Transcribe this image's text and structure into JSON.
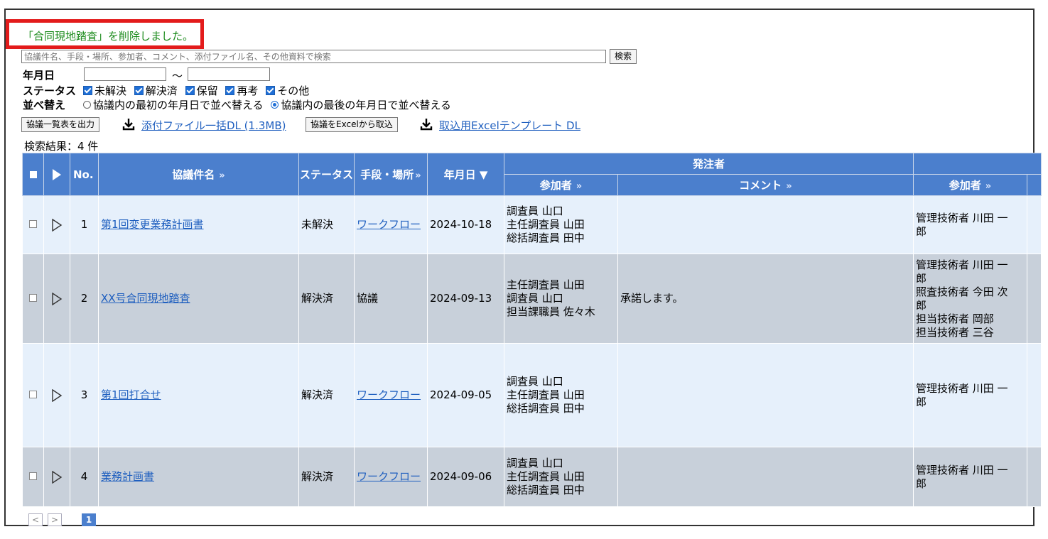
{
  "message": "「合同現地踏査」を削除しました。",
  "search": {
    "placeholder": "協議件名、手段・場所、参加者、コメント、添付ファイル名、その他資料で検索",
    "button": "検索"
  },
  "filters": {
    "date_label": "年月日",
    "tilde": "～",
    "status_label": "ステータス",
    "status_options": [
      "未解決",
      "解決済",
      "保留",
      "再考",
      "その他"
    ],
    "sort_label": "並べ替え",
    "sort_options": [
      "協議内の最初の年月日で並べ替える",
      "協議内の最後の年月日で並べ替える"
    ]
  },
  "actions": {
    "export_button": "協議一覧表を出力",
    "attach_dl": "添付ファイル一括DL (1.3MB)",
    "import_button": "協議をExcelから取込",
    "template_dl": "取込用Excelテンプレート DL"
  },
  "result_count": "検索結果：4 件",
  "table": {
    "headers": {
      "no": "No.",
      "title": "協議件名",
      "status": "ステータス",
      "method": "手段・場所",
      "date": "年月日 ▼",
      "orderer": "発注者",
      "participants": "参加者",
      "comment": "コメント",
      "contractor_participants": "参加者",
      "chev": "»"
    },
    "rows": [
      {
        "no": "1",
        "title": "第1回変更業務計画書",
        "status": "未解決",
        "method": "ワークフロー",
        "date": "2024-10-18",
        "participants": [
          "調査員 山口",
          "主任調査員 山田",
          "総括調査員 田中"
        ],
        "comment": "",
        "contractor": [
          "管理技術者 川田 一",
          "郎"
        ]
      },
      {
        "no": "2",
        "title": "XX号合同現地踏査",
        "status": "解決済",
        "method": "協議",
        "date": "2024-09-13",
        "participants": [
          "主任調査員 山田",
          "調査員 山口",
          "担当課職員 佐々木"
        ],
        "comment": "承諾します。",
        "contractor": [
          "管理技術者 川田 一",
          "郎",
          "照査技術者 今田 次",
          "郎",
          "担当技術者 岡部",
          "担当技術者 三谷"
        ]
      },
      {
        "no": "3",
        "title": "第1回打合せ",
        "status": "解決済",
        "method": "ワークフロー",
        "date": "2024-09-05",
        "participants": [
          "調査員 山口",
          "主任調査員 山田",
          "総括調査員 田中"
        ],
        "comment": "",
        "contractor": [
          "管理技術者 川田 一",
          "郎"
        ]
      },
      {
        "no": "4",
        "title": "業務計画書",
        "status": "解決済",
        "method": "ワークフロー",
        "date": "2024-09-06",
        "participants": [
          "調査員 山口",
          "主任調査員 山田",
          "総括調査員 田中"
        ],
        "comment": "",
        "contractor": [
          "管理技術者 川田 一",
          "郎"
        ]
      }
    ]
  },
  "pager": {
    "prev": "<",
    "next": ">",
    "current": "1"
  }
}
